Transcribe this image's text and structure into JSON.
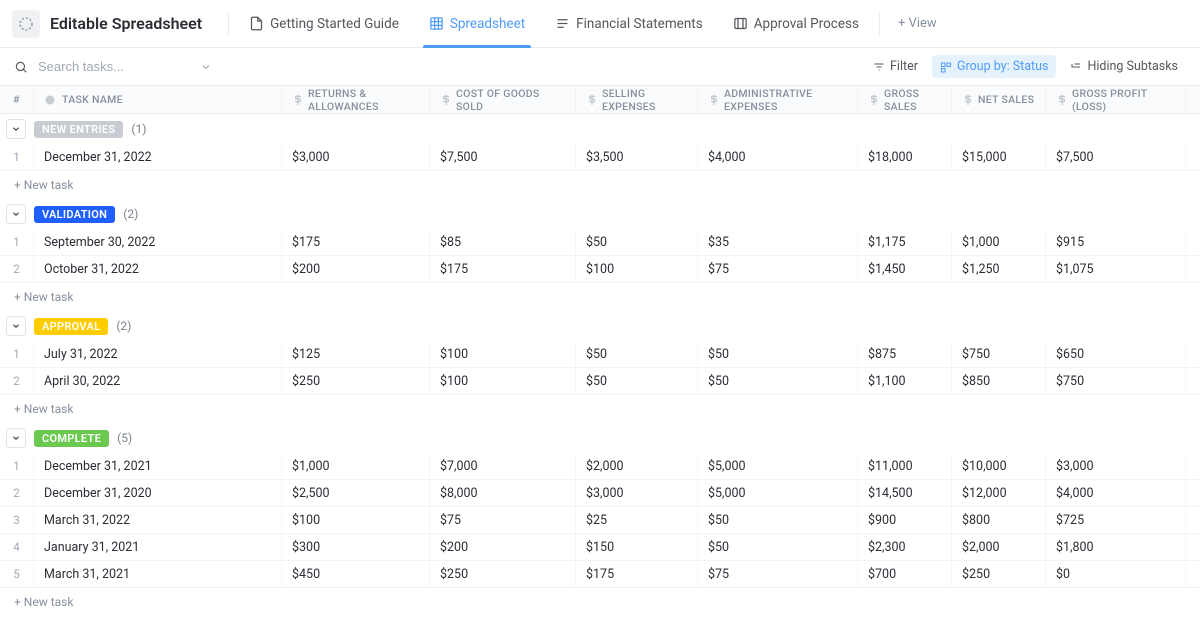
{
  "title": "Editable Spreadsheet",
  "tabs": [
    {
      "label": "Getting Started Guide",
      "active": false
    },
    {
      "label": "Spreadsheet",
      "active": true
    },
    {
      "label": "Financial Statements",
      "active": false
    },
    {
      "label": "Approval Process",
      "active": false
    }
  ],
  "addView": "+ View",
  "searchPlaceholder": "Search tasks...",
  "toolbar": {
    "filter": "Filter",
    "group": "Group by: Status",
    "hiding": "Hiding Subtasks"
  },
  "columns": {
    "num": "#",
    "name": "TASK NAME",
    "c1": "RETURNS & ALLOWANCES",
    "c2": "COST OF GOODS SOLD",
    "c3": "SELLING EXPENSES",
    "c4": "ADMINISTRATIVE EXPENSES",
    "c5": "GROSS SALES",
    "c6": "NET SALES",
    "c7": "GROSS PROFIT (LOSS)"
  },
  "newTask": "+ New task",
  "groups": [
    {
      "key": "new",
      "label": "NEW ENTRIES",
      "count": "(1)",
      "rows": [
        {
          "n": "1",
          "name": "December 31, 2022",
          "v": [
            "$3,000",
            "$7,500",
            "$3,500",
            "$4,000",
            "$18,000",
            "$15,000",
            "$7,500"
          ]
        }
      ]
    },
    {
      "key": "validation",
      "label": "VALIDATION",
      "count": "(2)",
      "rows": [
        {
          "n": "1",
          "name": "September 30, 2022",
          "v": [
            "$175",
            "$85",
            "$50",
            "$35",
            "$1,175",
            "$1,000",
            "$915"
          ]
        },
        {
          "n": "2",
          "name": "October 31, 2022",
          "v": [
            "$200",
            "$175",
            "$100",
            "$75",
            "$1,450",
            "$1,250",
            "$1,075"
          ]
        }
      ]
    },
    {
      "key": "approval",
      "label": "APPROVAL",
      "count": "(2)",
      "rows": [
        {
          "n": "1",
          "name": "July 31, 2022",
          "v": [
            "$125",
            "$100",
            "$50",
            "$50",
            "$875",
            "$750",
            "$650"
          ]
        },
        {
          "n": "2",
          "name": "April 30, 2022",
          "v": [
            "$250",
            "$100",
            "$50",
            "$50",
            "$1,100",
            "$850",
            "$750"
          ]
        }
      ]
    },
    {
      "key": "complete",
      "label": "COMPLETE",
      "count": "(5)",
      "rows": [
        {
          "n": "1",
          "name": "December 31, 2021",
          "v": [
            "$1,000",
            "$7,000",
            "$2,000",
            "$5,000",
            "$11,000",
            "$10,000",
            "$3,000"
          ]
        },
        {
          "n": "2",
          "name": "December 31, 2020",
          "v": [
            "$2,500",
            "$8,000",
            "$3,000",
            "$5,000",
            "$14,500",
            "$12,000",
            "$4,000"
          ]
        },
        {
          "n": "3",
          "name": "March 31, 2022",
          "v": [
            "$100",
            "$75",
            "$25",
            "$50",
            "$900",
            "$800",
            "$725"
          ]
        },
        {
          "n": "4",
          "name": "January 31, 2021",
          "v": [
            "$300",
            "$200",
            "$150",
            "$50",
            "$2,300",
            "$2,000",
            "$1,800"
          ]
        },
        {
          "n": "5",
          "name": "March 31, 2021",
          "v": [
            "$450",
            "$250",
            "$175",
            "$75",
            "$700",
            "$250",
            "$0"
          ]
        }
      ]
    }
  ]
}
